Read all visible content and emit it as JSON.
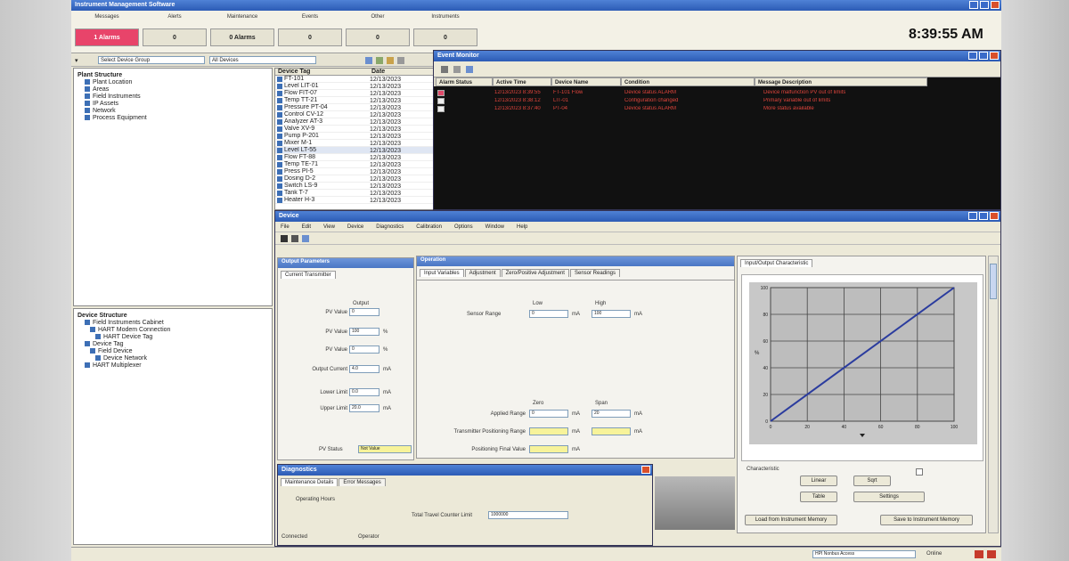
{
  "window": {
    "title": "Instrument Management Software"
  },
  "top": {
    "status_cols": [
      {
        "label": "Messages",
        "value": "1 Alarms",
        "alarm": true
      },
      {
        "label": "Alerts",
        "value": "0"
      },
      {
        "label": "Maintenance",
        "value": "0 Alarms"
      },
      {
        "label": "Events",
        "value": "0"
      },
      {
        "label": "Other",
        "value": "0"
      },
      {
        "label": "Instruments",
        "value": "0"
      }
    ],
    "clock": "8:39:55 AM"
  },
  "left": {
    "toolbar_text": "Select Device Group",
    "toolbar_text2": "All Devices",
    "tree_top_title": "Plant Structure",
    "tree_top": [
      "Plant Location",
      "Areas",
      "Field Instruments",
      "IP Assets",
      "Network",
      "Process Equipment"
    ],
    "tree_bottom_title": "Device Structure",
    "tree_bottom": [
      "Field Instruments Cabinet",
      "HART Modem Connection",
      "HART Device Tag",
      "Device Tag",
      "Field Device",
      "Device Network",
      "HART Multiplexer"
    ]
  },
  "list": {
    "col_name": "Device Tag",
    "col_date": "Date",
    "rows": [
      "FT-101",
      "Level LIT-01",
      "Flow FIT-07",
      "Temp TT-21",
      "Pressure PT-04",
      "Control CV-12",
      "Analyzer AT-3",
      "Valve XV-9",
      "Pump P-201",
      "Mixer M-1",
      "Level LT-55",
      "Flow FT-88",
      "Temp TE-71",
      "Press PI-5",
      "Dosing D-2",
      "Switch LS-9",
      "Tank T-7",
      "Heater H-3"
    ],
    "dates": "12/13/2023"
  },
  "events": {
    "title": "Event Monitor",
    "headers": [
      "Alarm Status",
      "Active Time",
      "Device Name",
      "Condition",
      "Message Description"
    ],
    "rows": [
      {
        "time": "12/13/2023 8:39:55",
        "name": "FT-101 Flow",
        "cond": "Device status ALARM",
        "msg": "Device malfunction PV out of limits"
      },
      {
        "time": "12/13/2023 8:38:12",
        "name": "LIT-01",
        "cond": "Configuration changed",
        "msg": "Primary variable out of limits"
      },
      {
        "time": "12/13/2023 8:37:40",
        "name": "PT-04",
        "cond": "Device status ALARM",
        "msg": "More status available"
      }
    ]
  },
  "device": {
    "title": "Device",
    "menu": [
      "File",
      "Edit",
      "View",
      "Device",
      "Diagnostics",
      "Calibration",
      "Options",
      "Window",
      "Help"
    ],
    "left_section": "Output Parameters",
    "left_tab": "Current Transmitter",
    "left_fields": [
      {
        "label": "PV Value",
        "value": "0"
      },
      {
        "label": "PV Value",
        "value": "100",
        "unit": "%"
      },
      {
        "label": "PV Value",
        "value": "0",
        "unit": "%"
      },
      {
        "label": "Output Current",
        "value": "4.0",
        "unit": "mA"
      },
      {
        "label": "Lower Limit",
        "value": "0.0",
        "unit": "mA"
      },
      {
        "label": "Upper Limit",
        "value": "20.0",
        "unit": "mA"
      }
    ],
    "left_col_hdr": "Output",
    "left_status": "PV Status",
    "left_status_val": "Not Value",
    "mid_section": "Operation",
    "mid_tabs": [
      "Input Variables",
      "Adjustment",
      "Zero/Positive Adjustment",
      "Sensor Readings"
    ],
    "mid_upper_hdr": [
      "Low",
      "High"
    ],
    "mid_upper_label": "Sensor Range",
    "mid_upper_vals": [
      "0",
      "100"
    ],
    "mid_lower_hdr": [
      "Zero",
      "Span"
    ],
    "mid_lower": [
      {
        "label": "Applied Range",
        "a": "0",
        "b": "20"
      },
      {
        "label": "Transmitter Positioning Range",
        "a": "",
        "b": ""
      },
      {
        "label": "Positioning Final Value",
        "a": "",
        "b": ""
      }
    ],
    "unit": "mA",
    "right_tab": "Input/Output Characteristic",
    "chart_data": {
      "type": "line",
      "x": [
        0,
        100
      ],
      "series": [
        {
          "values": [
            0,
            100
          ]
        }
      ],
      "xlim": [
        0,
        100
      ],
      "ylim": [
        0,
        100
      ],
      "x_ticks": [
        "0",
        "20",
        "40",
        "60",
        "80",
        "100"
      ],
      "y_ticks": [
        "0",
        "20",
        "40",
        "60",
        "80",
        "100"
      ],
      "ylabel": "%",
      "grid": true
    },
    "right_group": "Characteristic",
    "right_btns": [
      "Linear",
      "Sqrt",
      "Table",
      "Settings"
    ],
    "right_bottom_btns": [
      "Load from Instrument Memory",
      "Save to Instrument Memory"
    ]
  },
  "diag": {
    "title": "Diagnostics",
    "tabs": [
      "Maintenance Details",
      "Error Messages"
    ],
    "label1": "Operating Hours",
    "label2": "Total Travel Counter Limit",
    "value2": "1000000",
    "bottom_left": "Connected",
    "bottom_mid": "Operator"
  },
  "status": {
    "text": "HPI Nonbus Access",
    "text2": "Online"
  }
}
